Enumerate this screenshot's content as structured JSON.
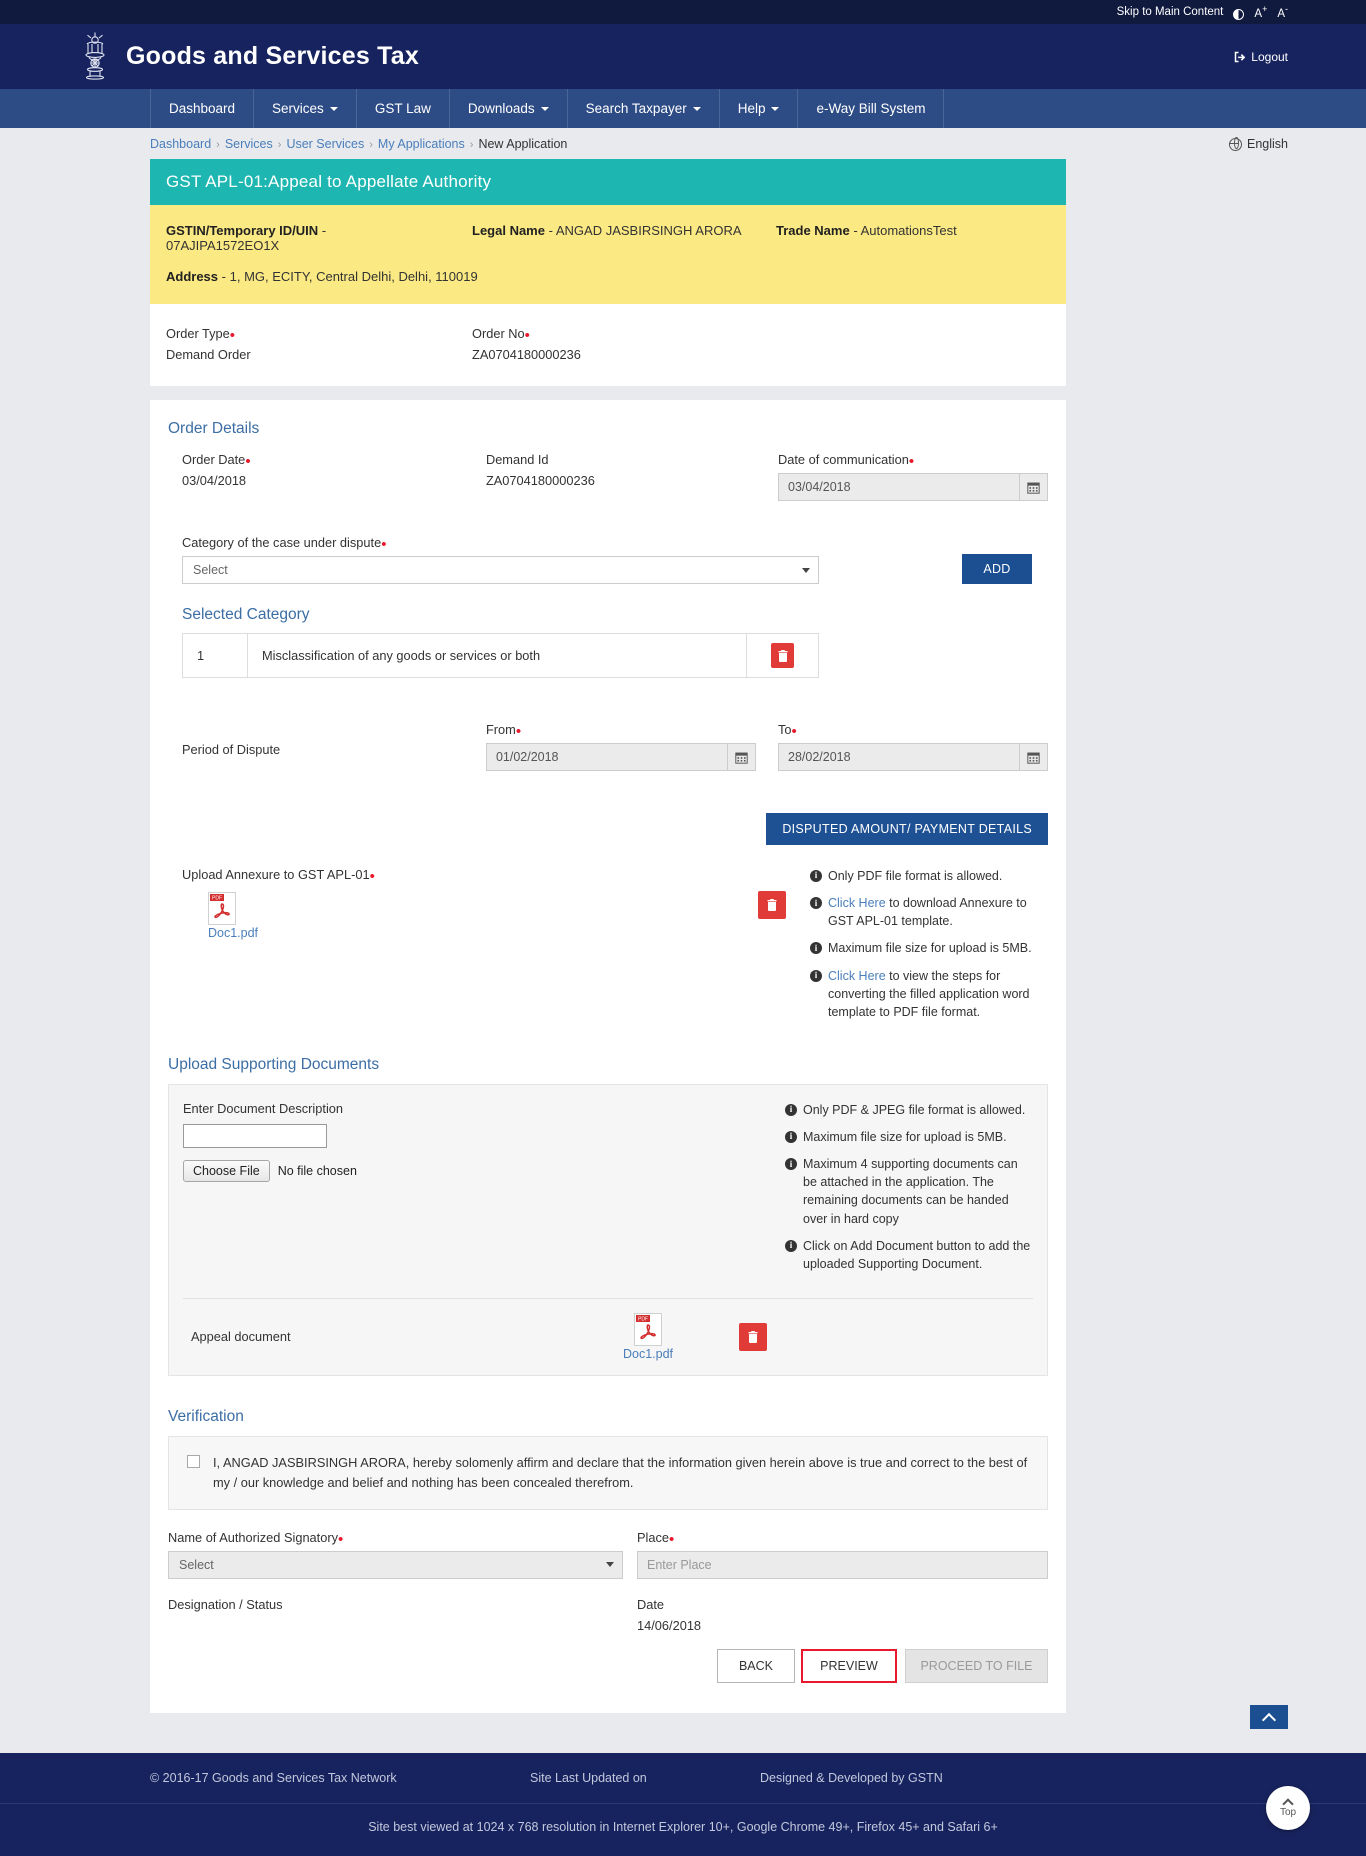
{
  "utility": {
    "skip_link": "Skip to Main Content",
    "contrast_icon": "contrast-icon",
    "font_increase": "A",
    "font_decrease": "A"
  },
  "header": {
    "emblem_icon": "india-emblem-icon",
    "title": "Goods and Services Tax",
    "logout_label": "Logout",
    "logout_icon": "logout-icon"
  },
  "nav": {
    "items": [
      {
        "label": "Dashboard",
        "has_caret": false
      },
      {
        "label": "Services",
        "has_caret": true
      },
      {
        "label": "GST Law",
        "has_caret": false
      },
      {
        "label": "Downloads",
        "has_caret": true
      },
      {
        "label": "Search Taxpayer",
        "has_caret": true
      },
      {
        "label": "Help",
        "has_caret": true
      },
      {
        "label": "e-Way Bill System",
        "has_caret": false
      }
    ]
  },
  "breadcrumb": {
    "items": [
      "Dashboard",
      "Services",
      "User Services",
      "My Applications"
    ],
    "current": "New Application",
    "language": "English",
    "globe_icon": "globe-icon"
  },
  "page": {
    "title": "GST APL-01:Appeal to Appellate Authority"
  },
  "taxpayer": {
    "gstin_label": "GSTIN/Temporary ID/UIN",
    "gstin_value": "07AJIPA1572EO1X",
    "legal_name_label": "Legal Name",
    "legal_name_value": "ANGAD JASBIRSINGH ARORA",
    "trade_name_label": "Trade Name",
    "trade_name_value": "AutomationsTest",
    "address_label": "Address",
    "address_value": "1, MG, ECITY, Central Delhi, Delhi, 110019",
    "dash": "-"
  },
  "order_summary": {
    "order_type_label": "Order Type",
    "order_type_value": "Demand Order",
    "order_no_label": "Order No",
    "order_no_value": "ZA0704180000236"
  },
  "order_details": {
    "section_title": "Order Details",
    "order_date_label": "Order Date",
    "order_date_value": "03/04/2018",
    "demand_id_label": "Demand Id",
    "demand_id_value": "ZA0704180000236",
    "communication_date_label": "Date of communication",
    "communication_date_value": "03/04/2018",
    "calendar_icon": "calendar-icon"
  },
  "category": {
    "label": "Category of the case under dispute",
    "select_value": "Select",
    "add_button": "ADD",
    "selected_title": "Selected Category",
    "rows": [
      {
        "index": "1",
        "name": "Misclassification of any goods or services or both",
        "delete_icon": "trash-icon"
      }
    ]
  },
  "period": {
    "label": "Period of Dispute",
    "from_label": "From",
    "from_value": "01/02/2018",
    "to_label": "To",
    "to_value": "28/02/2018",
    "calendar_icon": "calendar-icon"
  },
  "disputed": {
    "button": "DISPUTED AMOUNT/ PAYMENT DETAILS"
  },
  "annexure": {
    "label": "Upload Annexure to GST APL-01",
    "file_name": "Doc1.pdf",
    "pdf_icon": "pdf-file-icon",
    "delete_icon": "trash-icon",
    "hints": [
      {
        "text_before": "Only PDF file format is allowed.",
        "link": "",
        "text_after": ""
      },
      {
        "text_before": "",
        "link": "Click Here",
        "text_after": " to download Annexure to GST APL-01 template."
      },
      {
        "text_before": "Maximum file size for upload is 5MB.",
        "link": "",
        "text_after": ""
      },
      {
        "text_before": "",
        "link": "Click Here",
        "text_after": " to view the steps for converting the filled application word template to PDF file format."
      }
    ]
  },
  "supporting": {
    "section_title": "Upload Supporting Documents",
    "description_label": "Enter Document Description",
    "description_value": "",
    "choose_file_button": "Choose File",
    "no_file_text": "No file chosen",
    "doc_rows": [
      {
        "description": "Appeal document",
        "file_name": "Doc1.pdf",
        "pdf_icon": "pdf-file-icon",
        "delete_icon": "trash-icon"
      }
    ],
    "hints": [
      "Only PDF & JPEG file format is allowed.",
      "Maximum file size for upload is 5MB.",
      "Maximum 4 supporting documents can be attached in the application. The remaining documents can be handed over in hard copy",
      "Click on Add Document button to add the uploaded Supporting Document."
    ]
  },
  "verification": {
    "section_title": "Verification",
    "checkbox_checked": false,
    "declaration": "I, ANGAD JASBIRSINGH ARORA, hereby solomenly affirm and declare that the information given herein above is true and correct to the best of my / our knowledge and belief and nothing has been concealed therefrom.",
    "signatory_label": "Name of Authorized Signatory",
    "signatory_value": "Select",
    "place_label": "Place",
    "place_placeholder": "Enter Place",
    "designation_label": "Designation / Status",
    "designation_value": "",
    "date_label": "Date",
    "date_value": "14/06/2018"
  },
  "actions": {
    "back": "BACK",
    "preview": "PREVIEW",
    "proceed": "PROCEED TO FILE"
  },
  "footer": {
    "copyright": "© 2016-17 Goods and Services Tax Network",
    "last_updated": "Site Last Updated on",
    "designed_by": "Designed & Developed by GSTN",
    "best_viewed": "Site best viewed at 1024 x 768 resolution in Internet Explorer 10+, Google Chrome 49+, Firefox 45+ and Safari 6+",
    "scroll_top_label": "Top"
  },
  "colors": {
    "brand_navy": "#17235e",
    "nav_blue": "#2d4b84",
    "teal_title": "#1db6b1",
    "yellow_panel": "#fbe983",
    "accent_red": "#e8192c",
    "link_blue": "#4a7ebb",
    "button_blue": "#1b4f91"
  }
}
